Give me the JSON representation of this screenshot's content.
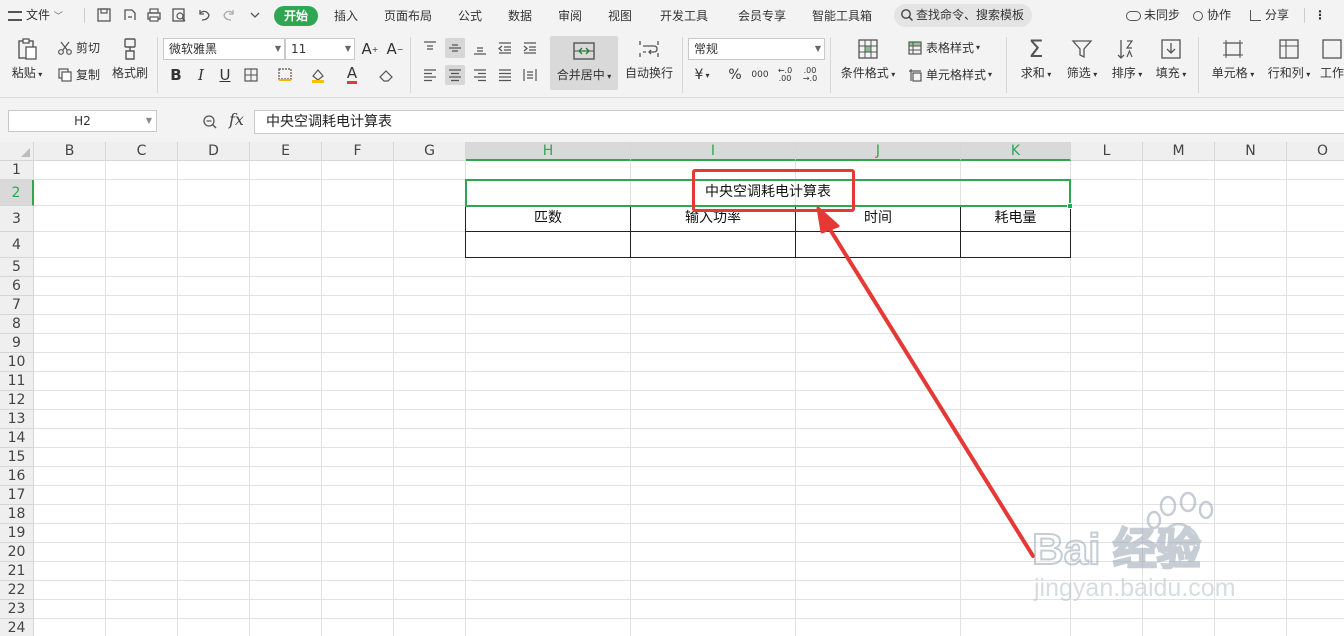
{
  "menubar": {
    "file_label": "文件",
    "tabs": [
      {
        "label": "开始",
        "active": true
      },
      {
        "label": "插入"
      },
      {
        "label": "页面布局"
      },
      {
        "label": "公式"
      },
      {
        "label": "数据"
      },
      {
        "label": "审阅"
      },
      {
        "label": "视图"
      },
      {
        "label": "开发工具"
      },
      {
        "label": "会员专享"
      },
      {
        "label": "智能工具箱"
      }
    ],
    "search_placeholder": "查找命令、搜索模板",
    "right": {
      "sync": "未同步",
      "collab": "协作",
      "share": "分享"
    }
  },
  "ribbon": {
    "paste": "粘贴",
    "cut": "剪切",
    "copy": "复制",
    "format_painter": "格式刷",
    "font_name": "微软雅黑",
    "font_size": "11",
    "merge_center": "合并居中",
    "wrap_text": "自动换行",
    "number_format": "常规",
    "conditional_format": "条件格式",
    "table_style": "表格样式",
    "cell_style": "单元格样式",
    "sum": "求和",
    "filter": "筛选",
    "sort": "排序",
    "fill": "填充",
    "cell": "单元格",
    "row_col": "行和列",
    "worksheet": "工作"
  },
  "formula_bar": {
    "name_box": "H2",
    "fx": "fx",
    "formula": "中央空调耗电计算表"
  },
  "grid": {
    "columns": [
      "B",
      "C",
      "D",
      "E",
      "F",
      "G",
      "H",
      "I",
      "J",
      "K",
      "L",
      "M",
      "N",
      "O"
    ],
    "rows": [
      "1",
      "2",
      "3",
      "4",
      "5",
      "6",
      "7",
      "8",
      "9",
      "10",
      "11",
      "12",
      "13",
      "14",
      "15",
      "16",
      "17",
      "18",
      "19",
      "20",
      "21",
      "22",
      "23",
      "24"
    ],
    "selected_cell": "H2",
    "table_title": "中央空调耗电计算表",
    "table_headers": [
      "匹数",
      "输入功率",
      "时间",
      "耗电量"
    ]
  },
  "watermark": {
    "brand": "Bai 经验",
    "url": "jingyan.baidu.com"
  },
  "colors": {
    "accent": "#2fa651",
    "annotation": "#e53935"
  }
}
